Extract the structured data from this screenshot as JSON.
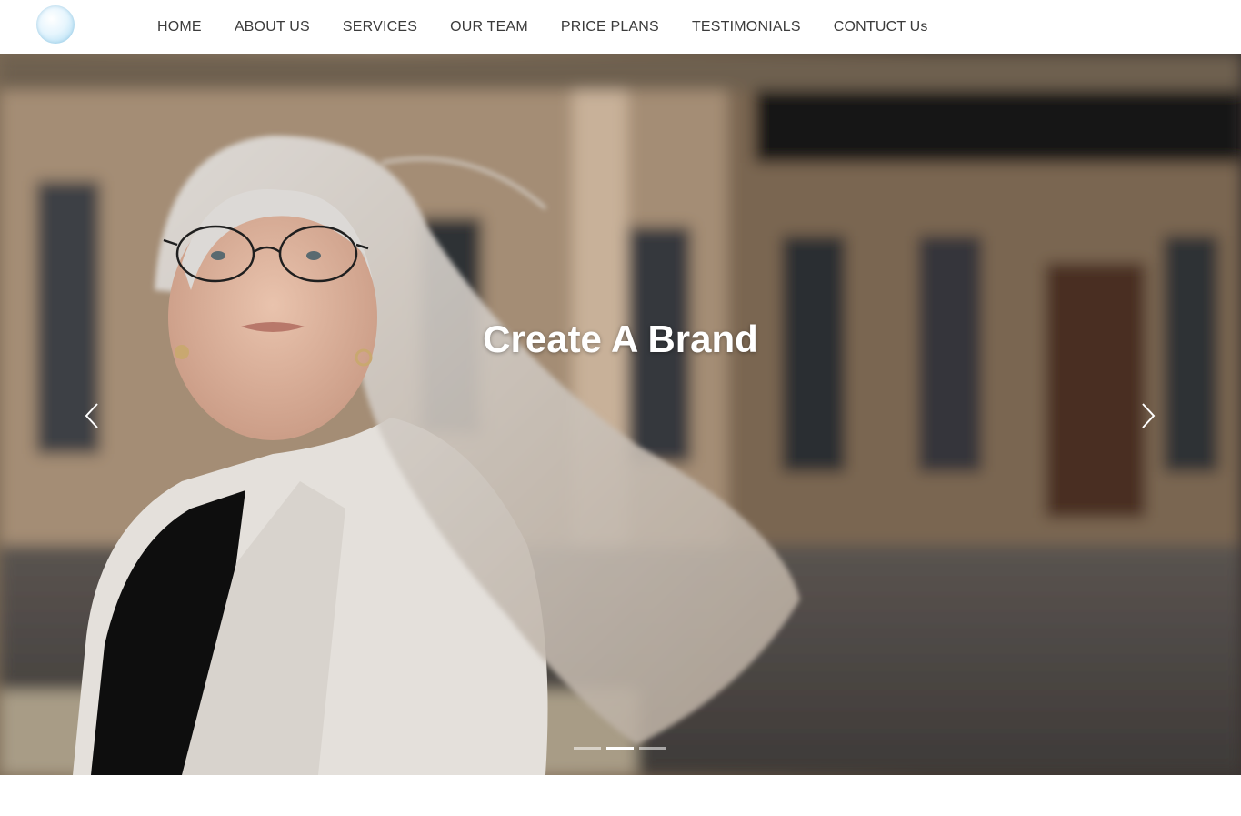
{
  "nav": {
    "items": [
      {
        "label": "HOME"
      },
      {
        "label": "ABOUT US"
      },
      {
        "label": "SERVICES"
      },
      {
        "label": "OUR TEAM"
      },
      {
        "label": "PRICE PLANS"
      },
      {
        "label": "TESTIMONIALS"
      },
      {
        "label": "CONTUCT Us"
      }
    ]
  },
  "hero": {
    "title": "Create A Brand",
    "slide_count": 3,
    "active_slide": 2,
    "prev_icon": "chevron-left-icon",
    "next_icon": "chevron-right-icon"
  },
  "colors": {
    "nav_text": "#3b3b3b",
    "hero_title": "#ffffff"
  }
}
